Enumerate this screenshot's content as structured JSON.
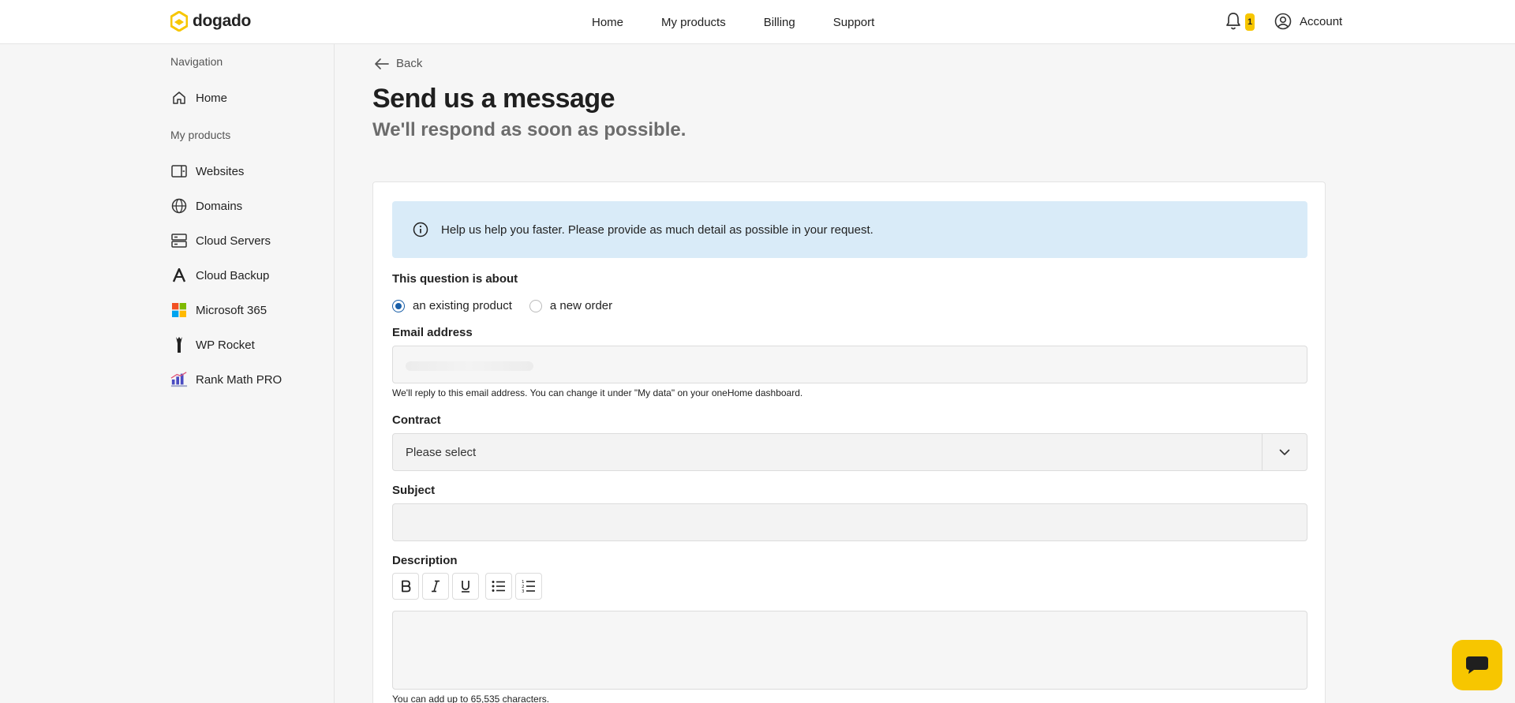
{
  "header": {
    "brand": "dogado",
    "nav": [
      "Home",
      "My products",
      "Billing",
      "Support"
    ],
    "notification_count": "1",
    "account_label": "Account",
    "accent_color": "#f7c600"
  },
  "sidebar": {
    "navigation_heading": "Navigation",
    "home_label": "Home",
    "products_heading": "My products",
    "products": [
      {
        "label": "Websites",
        "icon": "website-icon"
      },
      {
        "label": "Domains",
        "icon": "globe-icon"
      },
      {
        "label": "Cloud Servers",
        "icon": "server-icon"
      },
      {
        "label": "Cloud Backup",
        "icon": "backup-icon"
      },
      {
        "label": "Microsoft 365",
        "icon": "microsoft-icon"
      },
      {
        "label": "WP Rocket",
        "icon": "rocket-icon"
      },
      {
        "label": "Rank Math PRO",
        "icon": "rank-math-icon"
      }
    ]
  },
  "main": {
    "back_label": "Back",
    "title": "Send us a message",
    "subtitle": "We'll respond as soon as possible.",
    "info_text": "Help us help you faster. Please provide as much detail as possible in your request.",
    "question_label": "This question is about",
    "radio_options": [
      "an existing product",
      "a new order"
    ],
    "radio_selected": "an existing product",
    "email_label": "Email address",
    "email_hint": "We'll reply to this email address. You can change it under \"My data\" on your oneHome dashboard.",
    "contract_label": "Contract",
    "contract_placeholder": "Please select",
    "subject_label": "Subject",
    "description_label": "Description",
    "description_hint": "You can add up to 65,535 characters."
  }
}
